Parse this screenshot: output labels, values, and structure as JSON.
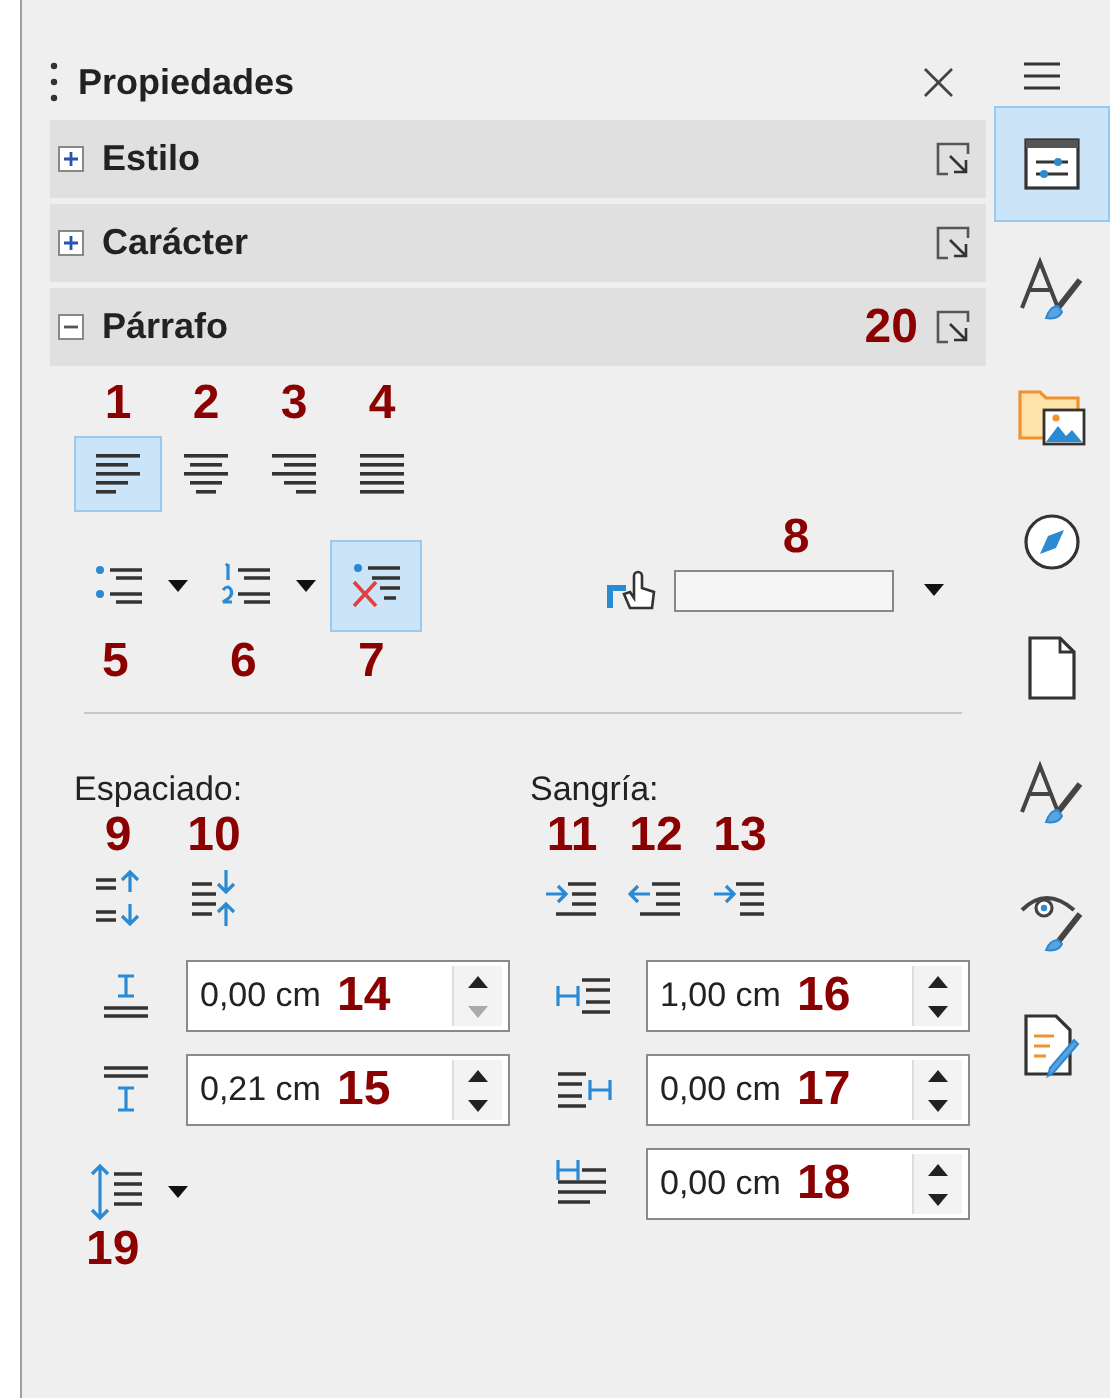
{
  "panel": {
    "title": "Propiedades",
    "close": "×"
  },
  "sections": [
    {
      "title": "Estilo",
      "expanded": false
    },
    {
      "title": "Carácter",
      "expanded": false
    },
    {
      "title": "Párrafo",
      "expanded": true,
      "callout": "20"
    }
  ],
  "alignment": [
    {
      "kind": "left",
      "callout": "1",
      "selected": true
    },
    {
      "kind": "center",
      "callout": "2",
      "selected": false
    },
    {
      "kind": "right",
      "callout": "3",
      "selected": false
    },
    {
      "kind": "justify",
      "callout": "4",
      "selected": false
    }
  ],
  "lists": [
    {
      "kind": "bullets",
      "callout": "5",
      "selected": false
    },
    {
      "kind": "numbered",
      "callout": "6",
      "selected": false
    },
    {
      "kind": "none",
      "callout": "7",
      "selected": true
    }
  ],
  "highlight": {
    "callout": "8"
  },
  "spacing": {
    "label": "Espaciado:",
    "buttons": [
      {
        "kind": "increase",
        "callout": "9"
      },
      {
        "kind": "decrease",
        "callout": "10"
      }
    ],
    "fields": [
      {
        "kind": "above",
        "value": "0,00 cm",
        "callout": "14",
        "down_disabled": true
      },
      {
        "kind": "below",
        "value": "0,21 cm",
        "callout": "15",
        "down_disabled": false
      }
    ],
    "line_spacing": {
      "callout": "19"
    }
  },
  "indent": {
    "label": "Sangría:",
    "buttons": [
      {
        "kind": "increase",
        "callout": "11"
      },
      {
        "kind": "decrease",
        "callout": "12"
      },
      {
        "kind": "hanging",
        "callout": "13"
      }
    ],
    "fields": [
      {
        "kind": "before",
        "value": "1,00 cm",
        "callout": "16",
        "down_disabled": false
      },
      {
        "kind": "after",
        "value": "0,00 cm",
        "callout": "17",
        "down_disabled": false
      },
      {
        "kind": "first",
        "value": "0,00 cm",
        "callout": "18",
        "down_disabled": false
      }
    ]
  },
  "sidebar_tabs": [
    {
      "kind": "properties",
      "selected": true
    },
    {
      "kind": "styles",
      "selected": false
    },
    {
      "kind": "gallery",
      "selected": false
    },
    {
      "kind": "navigator",
      "selected": false
    },
    {
      "kind": "page",
      "selected": false
    },
    {
      "kind": "inspector",
      "selected": false
    },
    {
      "kind": "design",
      "selected": false
    },
    {
      "kind": "changes",
      "selected": false
    }
  ]
}
